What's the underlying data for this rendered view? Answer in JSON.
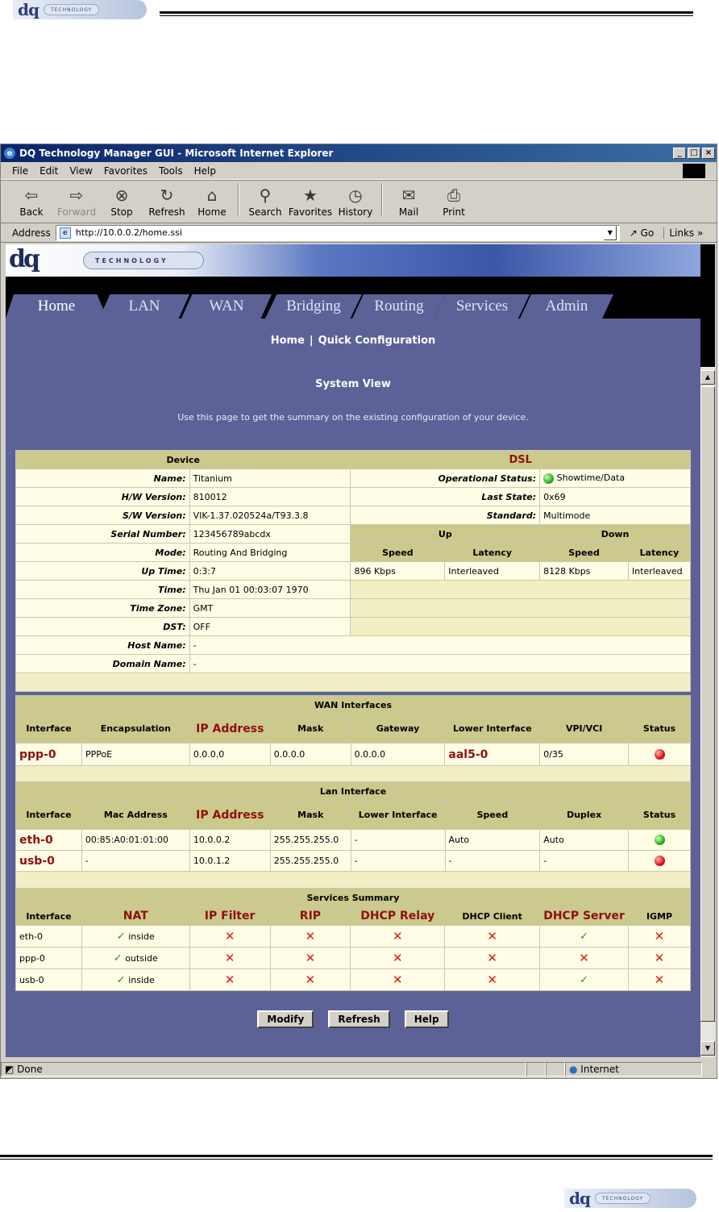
{
  "doc": {
    "logo_text": "dq",
    "logo_sub": "TECHNOLOGY"
  },
  "window": {
    "title": "DQ Technology Manager GUI - Microsoft Internet Explorer",
    "menu": [
      "File",
      "Edit",
      "View",
      "Favorites",
      "Tools",
      "Help"
    ],
    "toolbar": [
      {
        "label": "Back",
        "icon": "back-arrow-icon",
        "glyph": "⇦"
      },
      {
        "label": "Forward",
        "icon": "forward-arrow-icon",
        "glyph": "⇨"
      },
      {
        "label": "Stop",
        "icon": "stop-icon",
        "glyph": "⊗"
      },
      {
        "label": "Refresh",
        "icon": "refresh-icon",
        "glyph": "↻"
      },
      {
        "label": "Home",
        "icon": "home-icon",
        "glyph": "⌂"
      },
      {
        "label": "Search",
        "icon": "search-icon",
        "glyph": "⚲"
      },
      {
        "label": "Favorites",
        "icon": "favorites-icon",
        "glyph": "★"
      },
      {
        "label": "History",
        "icon": "history-icon",
        "glyph": "◷"
      },
      {
        "label": "Mail",
        "icon": "mail-icon",
        "glyph": "✉"
      },
      {
        "label": "Print",
        "icon": "print-icon",
        "glyph": "⎙"
      }
    ],
    "address_label": "Address",
    "url": "http://10.0.0.2/home.ssi",
    "go_label": "Go",
    "links_label": "Links",
    "status_text": "Done",
    "zone_text": "Internet"
  },
  "page": {
    "tabs": [
      "Home",
      "LAN",
      "WAN",
      "Bridging",
      "Routing",
      "Services",
      "Admin"
    ],
    "subnav": [
      "Home",
      "Quick Configuration"
    ],
    "title": "System View",
    "description": "Use this page to get the summary on the existing configuration of your device."
  },
  "device": {
    "header": "Device",
    "rows": [
      {
        "label": "Name:",
        "value": "Titanium"
      },
      {
        "label": "H/W Version:",
        "value": "810012"
      },
      {
        "label": "S/W Version:",
        "value": "VIK-1.37.020524a/T93.3.8"
      },
      {
        "label": "Serial Number:",
        "value": "123456789abcdx"
      },
      {
        "label": "Mode:",
        "value": "Routing And Bridging"
      },
      {
        "label": "Up Time:",
        "value": "0:3:7"
      },
      {
        "label": "Time:",
        "value": "Thu Jan 01 00:03:07 1970"
      },
      {
        "label": "Time Zone:",
        "value": "GMT"
      },
      {
        "label": "DST:",
        "value": "OFF"
      },
      {
        "label": "Host Name:",
        "value": "-"
      },
      {
        "label": "Domain Name:",
        "value": "-"
      }
    ]
  },
  "dsl": {
    "header": "DSL",
    "operational_status_label": "Operational Status:",
    "operational_status": "Showtime/Data",
    "last_state_label": "Last State:",
    "last_state": "0x69",
    "standard_label": "Standard:",
    "standard": "Multimode",
    "up_label": "Up",
    "down_label": "Down",
    "speed_label": "Speed",
    "latency_label": "Latency",
    "up_speed": "896 Kbps",
    "up_latency": "Interleaved",
    "down_speed": "8128 Kbps",
    "down_latency": "Interleaved"
  },
  "wan": {
    "title": "WAN Interfaces",
    "columns": [
      "Interface",
      "Encapsulation",
      "IP Address",
      "Mask",
      "Gateway",
      "Lower Interface",
      "VPI/VCI",
      "Status"
    ],
    "rows": [
      {
        "interface": "ppp-0",
        "encapsulation": "PPPoE",
        "ip": "0.0.0.0",
        "mask": "0.0.0.0",
        "gateway": "0.0.0.0",
        "lower": "aal5-0",
        "vpivci": "0/35",
        "status": "red"
      }
    ]
  },
  "lan": {
    "title": "Lan Interface",
    "columns": [
      "Interface",
      "Mac Address",
      "IP Address",
      "Mask",
      "Lower Interface",
      "Speed",
      "Duplex",
      "Status"
    ],
    "rows": [
      {
        "interface": "eth-0",
        "mac": "00:85:A0:01:01:00",
        "ip": "10.0.0.2",
        "mask": "255.255.255.0",
        "lower": "-",
        "speed": "Auto",
        "duplex": "Auto",
        "status": "green"
      },
      {
        "interface": "usb-0",
        "mac": "-",
        "ip": "10.0.1.2",
        "mask": "255.255.255.0",
        "lower": "-",
        "speed": "-",
        "duplex": "-",
        "status": "red"
      }
    ]
  },
  "services": {
    "title": "Services Summary",
    "columns": [
      "Interface",
      "NAT",
      "IP Filter",
      "RIP",
      "DHCP Relay",
      "DHCP Client",
      "DHCP Server",
      "IGMP"
    ],
    "rows": [
      {
        "interface": "eth-0",
        "nat": "inside",
        "dhcp_server": "yes"
      },
      {
        "interface": "ppp-0",
        "nat": "outside",
        "dhcp_server": "no"
      },
      {
        "interface": "usb-0",
        "nat": "inside",
        "dhcp_server": "yes"
      }
    ]
  },
  "buttons": {
    "modify": "Modify",
    "refresh": "Refresh",
    "help": "Help"
  }
}
